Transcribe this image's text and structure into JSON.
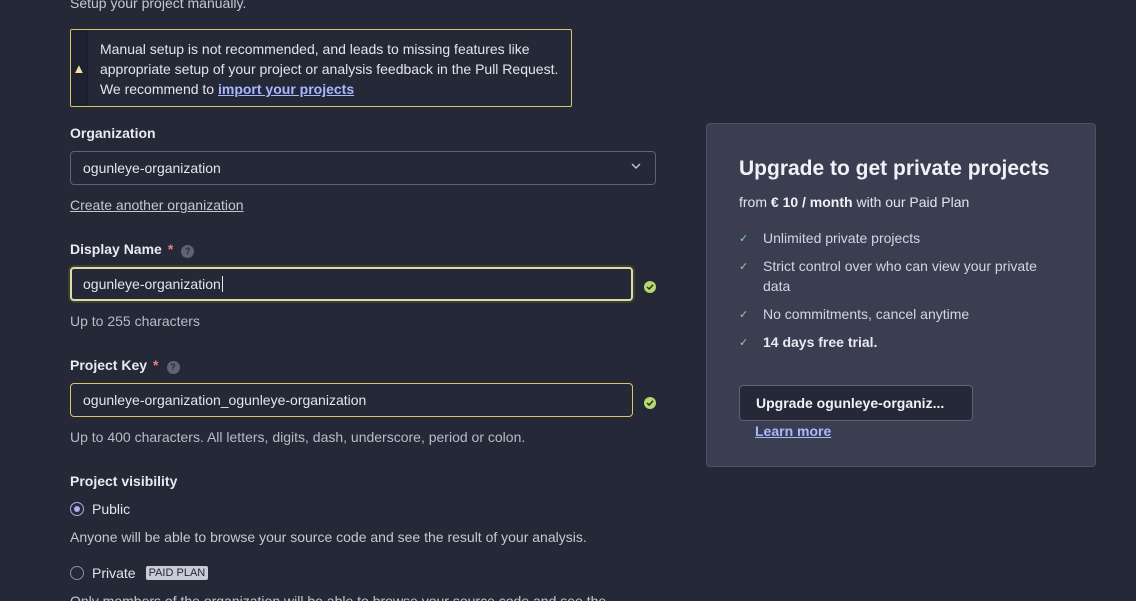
{
  "intro": {
    "text": "Setup your project manually."
  },
  "warning": {
    "icon": "warning-icon",
    "text": "Manual setup is not recommended, and leads to missing features like appropriate setup of your project or analysis feedback in the Pull Request. We recommend to",
    "link": "import your projects"
  },
  "organization": {
    "label": "Organization",
    "value": "ogunleye-organization",
    "create_link": "Create another organization"
  },
  "display_name": {
    "label": "Display Name",
    "required": "*",
    "value": "ogunleye-organization",
    "hint": "Up to 255 characters"
  },
  "project_key": {
    "label": "Project Key",
    "required": "*",
    "value": "ogunleye-organization_ogunleye-organization",
    "hint": "Up to 400 characters. All letters, digits, dash, underscore, period or colon."
  },
  "visibility": {
    "label": "Project visibility",
    "public_label": "Public",
    "public_desc": "Anyone will be able to browse your source code and see the result of your analysis.",
    "private_label": "Private",
    "paid_badge": "PAID PLAN",
    "private_desc": "Only members of the organization will be able to browse your source code and see the"
  },
  "upgrade": {
    "title": "Upgrade to get private projects",
    "sub_from": "from",
    "price": "€ 10 / month",
    "sub_rest": "with our Paid Plan",
    "benefits": [
      "Unlimited private projects",
      "Strict control over who can view your private data",
      "No commitments, cancel anytime",
      "14 days free trial."
    ],
    "button": "Upgrade ogunleye-organiz...",
    "learn_more": "Learn more"
  },
  "colors": {
    "background": "#252836",
    "warning_border": "#e2c56b",
    "link": "#a8b8ff",
    "success": "#b6d96b",
    "card_bg": "#3b3e50"
  }
}
